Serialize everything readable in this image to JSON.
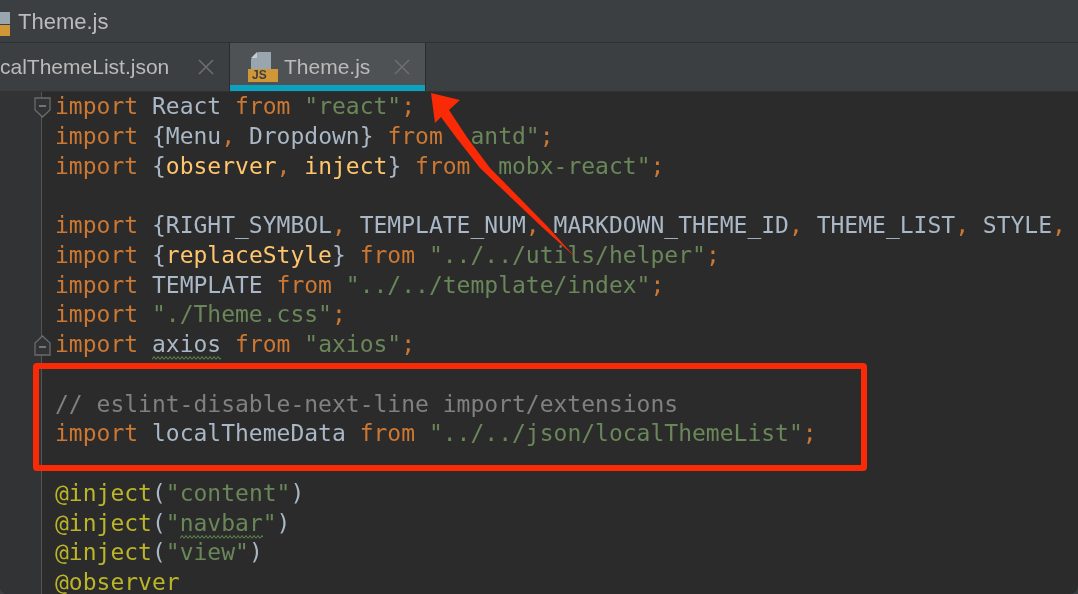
{
  "window": {
    "title": "Theme.js"
  },
  "tabs": [
    {
      "label": "calThemeList.json",
      "selected": false
    },
    {
      "label": "Theme.js",
      "badge": "JS",
      "selected": true
    }
  ],
  "editor": {
    "lines": [
      {
        "kind": "code",
        "fold": {
          "kind": "start"
        },
        "tokens": [
          {
            "kind": "keyword",
            "text": "import "
          },
          {
            "kind": "identifier",
            "text": "React "
          },
          {
            "kind": "keyword",
            "text": "from "
          },
          {
            "kind": "string",
            "text": "\"react\""
          },
          {
            "kind": "separator",
            "text": ";"
          }
        ]
      },
      {
        "kind": "code",
        "tokens": [
          {
            "kind": "keyword",
            "text": "import "
          },
          {
            "kind": "identifier",
            "text": "{Menu"
          },
          {
            "kind": "separator",
            "text": ", "
          },
          {
            "kind": "identifier",
            "text": "Dropdown} "
          },
          {
            "kind": "keyword",
            "text": "from  "
          },
          {
            "kind": "string",
            "text": "antd\""
          },
          {
            "kind": "separator",
            "text": ";"
          }
        ]
      },
      {
        "kind": "code",
        "tokens": [
          {
            "kind": "keyword",
            "text": "import "
          },
          {
            "kind": "identifier",
            "text": "{"
          },
          {
            "kind": "function",
            "text": "observer"
          },
          {
            "kind": "separator",
            "text": ", "
          },
          {
            "kind": "function",
            "text": "inject"
          },
          {
            "kind": "identifier",
            "text": "} "
          },
          {
            "kind": "keyword",
            "text": "from  "
          },
          {
            "kind": "string",
            "text": "mobx-react\""
          },
          {
            "kind": "separator",
            "text": ";"
          }
        ]
      },
      {
        "kind": "blank"
      },
      {
        "kind": "code",
        "tokens": [
          {
            "kind": "keyword",
            "text": "import "
          },
          {
            "kind": "identifier",
            "text": "{RIGHT_SYMBOL"
          },
          {
            "kind": "separator",
            "text": ", "
          },
          {
            "kind": "identifier",
            "text": "TEMPLATE_NUM"
          },
          {
            "kind": "separator",
            "text": ", "
          },
          {
            "kind": "identifier",
            "text": "MARKDOWN_THEME_ID"
          },
          {
            "kind": "separator",
            "text": ", "
          },
          {
            "kind": "identifier",
            "text": "THEME_LIST"
          },
          {
            "kind": "separator",
            "text": ", "
          },
          {
            "kind": "identifier",
            "text": "STYLE"
          },
          {
            "kind": "separator",
            "text": ","
          }
        ]
      },
      {
        "kind": "code",
        "tokens": [
          {
            "kind": "keyword",
            "text": "import "
          },
          {
            "kind": "identifier",
            "text": "{"
          },
          {
            "kind": "function",
            "text": "replaceStyle"
          },
          {
            "kind": "identifier",
            "text": "} "
          },
          {
            "kind": "keyword",
            "text": "from "
          },
          {
            "kind": "string",
            "text": "\"../../utils/helper\""
          },
          {
            "kind": "separator",
            "text": ";"
          }
        ]
      },
      {
        "kind": "code",
        "tokens": [
          {
            "kind": "keyword",
            "text": "import "
          },
          {
            "kind": "identifier",
            "text": "TEMPLATE "
          },
          {
            "kind": "keyword",
            "text": "from "
          },
          {
            "kind": "string",
            "text": "\"../../template/index\""
          },
          {
            "kind": "separator",
            "text": ";"
          }
        ]
      },
      {
        "kind": "code",
        "tokens": [
          {
            "kind": "keyword",
            "text": "import "
          },
          {
            "kind": "string",
            "text": "\"./Theme.css\""
          },
          {
            "kind": "separator",
            "text": ";"
          }
        ]
      },
      {
        "kind": "code",
        "fold": {
          "kind": "end"
        },
        "tokens": [
          {
            "kind": "keyword",
            "text": "import "
          },
          {
            "kind": "identifier",
            "text": "axios",
            "typo": true
          },
          {
            "kind": "keyword",
            "text": " from "
          },
          {
            "kind": "string",
            "text": "\"axios\""
          },
          {
            "kind": "separator",
            "text": ";"
          }
        ]
      },
      {
        "kind": "blank"
      },
      {
        "kind": "code",
        "tokens": [
          {
            "kind": "comment",
            "text": "// eslint-disable-next-line import/extensions"
          }
        ]
      },
      {
        "kind": "code",
        "tokens": [
          {
            "kind": "keyword",
            "text": "import "
          },
          {
            "kind": "identifier",
            "text": "localThemeData "
          },
          {
            "kind": "keyword",
            "text": "from "
          },
          {
            "kind": "string",
            "text": "\"../../json/localThemeList\""
          },
          {
            "kind": "separator",
            "text": ";"
          }
        ]
      },
      {
        "kind": "blank"
      },
      {
        "kind": "code",
        "tokens": [
          {
            "kind": "decorator",
            "text": "@inject"
          },
          {
            "kind": "identifier",
            "text": "("
          },
          {
            "kind": "string",
            "text": "\"content\""
          },
          {
            "kind": "identifier",
            "text": ")"
          }
        ]
      },
      {
        "kind": "code",
        "tokens": [
          {
            "kind": "decorator",
            "text": "@inject"
          },
          {
            "kind": "identifier",
            "text": "("
          },
          {
            "kind": "string",
            "text": "\""
          },
          {
            "kind": "string",
            "text": "navbar",
            "typo": true
          },
          {
            "kind": "string",
            "text": "\""
          },
          {
            "kind": "identifier",
            "text": ")"
          }
        ]
      },
      {
        "kind": "code",
        "tokens": [
          {
            "kind": "decorator",
            "text": "@inject"
          },
          {
            "kind": "identifier",
            "text": "("
          },
          {
            "kind": "string",
            "text": "\"view\""
          },
          {
            "kind": "identifier",
            "text": ")"
          }
        ]
      },
      {
        "kind": "code",
        "tokens": [
          {
            "kind": "decorator",
            "text": "@observer"
          }
        ]
      }
    ]
  }
}
